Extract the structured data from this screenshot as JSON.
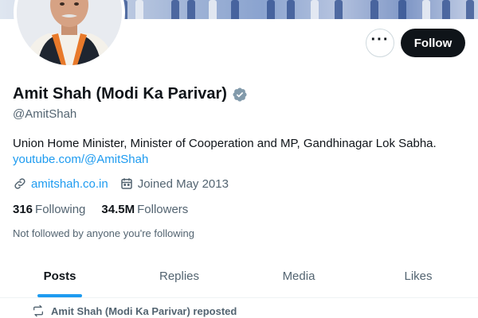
{
  "profile": {
    "display_name": "Amit Shah (Modi Ka Parivar)",
    "handle": "@AmitShah",
    "bio": "Union Home Minister, Minister of Cooperation and MP, Gandhinagar Lok Sabha.",
    "bio_link": "youtube.com/@AmitShah",
    "website": "amitshah.co.in",
    "joined": "Joined May 2013",
    "following_count": "316",
    "following_label": "Following",
    "followers_count": "34.5M",
    "followers_label": "Followers",
    "not_followed_text": "Not followed by anyone you're following"
  },
  "actions": {
    "more_label": "···",
    "follow_label": "Follow"
  },
  "tabs": [
    {
      "label": "Posts",
      "active": true
    },
    {
      "label": "Replies",
      "active": false
    },
    {
      "label": "Media",
      "active": false
    },
    {
      "label": "Likes",
      "active": false
    }
  ],
  "timeline": {
    "repost_text": "Amit Shah (Modi Ka Parivar) reposted"
  },
  "icons": {
    "verified": "verified-badge-icon",
    "link": "link-icon",
    "calendar": "calendar-icon",
    "more": "more-horizontal-icon",
    "repost": "repost-icon"
  },
  "colors": {
    "accent": "#1d9bf0",
    "text_primary": "#0f1419",
    "text_secondary": "#536471",
    "verified": "#829aab",
    "follow_button_bg": "#0f1419"
  }
}
